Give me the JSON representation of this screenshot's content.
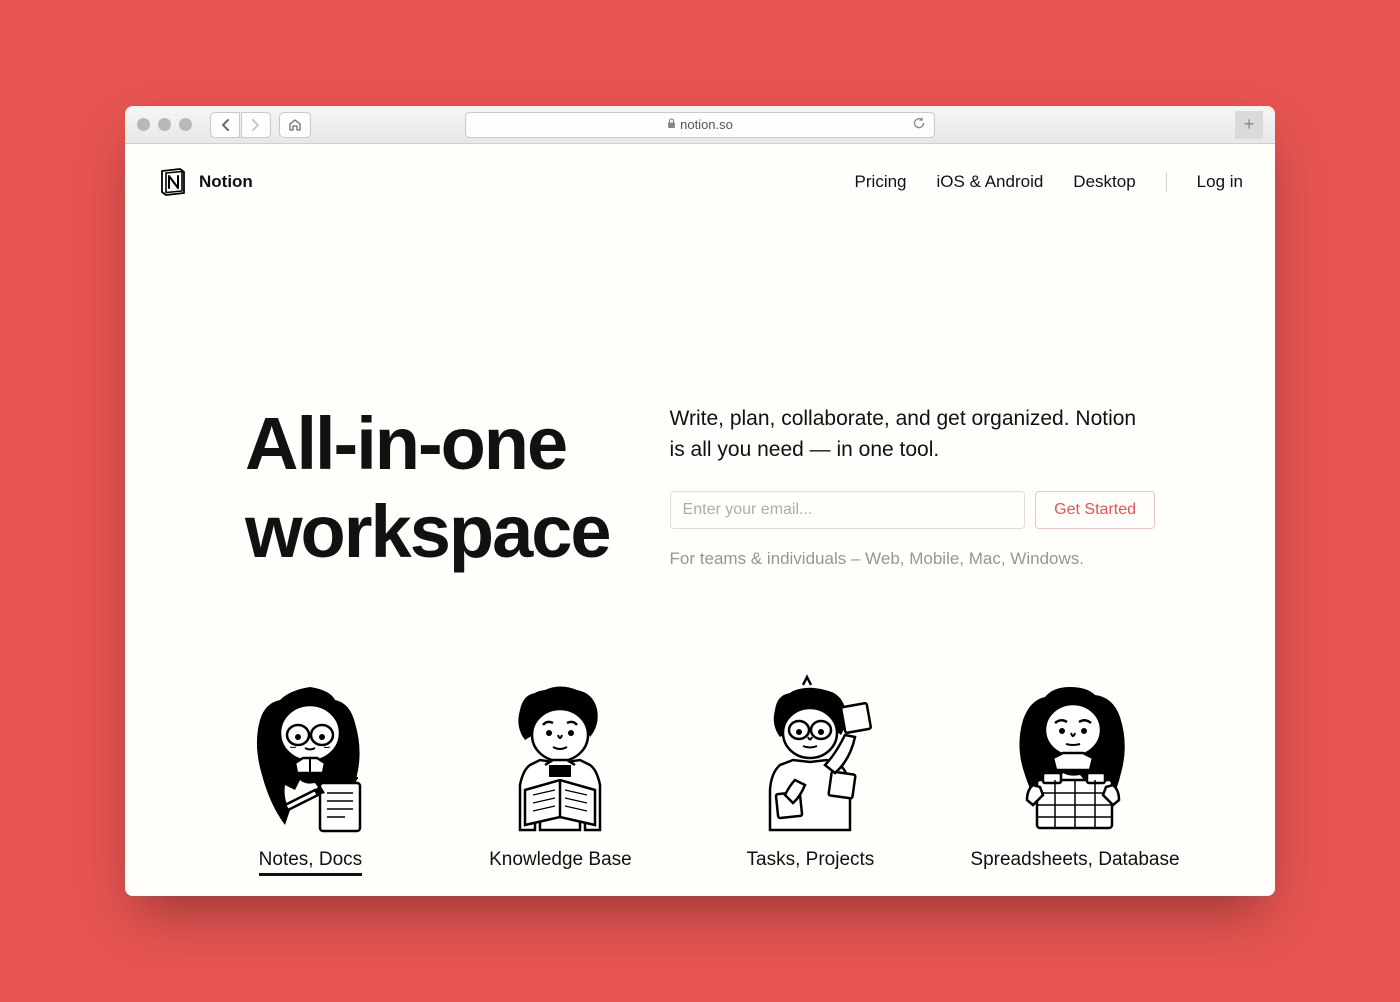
{
  "browser": {
    "url_host": "notion.so"
  },
  "brand": {
    "name": "Notion"
  },
  "nav": {
    "links": [
      "Pricing",
      "iOS & Android",
      "Desktop"
    ],
    "login": "Log in"
  },
  "hero": {
    "title_line1": "All-in-one",
    "title_line2": "workspace",
    "description": "Write, plan, collaborate, and get organized. Notion is all you need — in one tool.",
    "email_placeholder": "Enter your email...",
    "cta": "Get Started",
    "meta": "For teams & individuals – Web, Mobile, Mac, Windows."
  },
  "features": [
    {
      "label": "Notes, Docs",
      "active": true
    },
    {
      "label": "Knowledge Base",
      "active": false
    },
    {
      "label": "Tasks, Projects",
      "active": false
    },
    {
      "label": "Spreadsheets, Database",
      "active": false
    }
  ],
  "colors": {
    "accent": "#e55451"
  }
}
